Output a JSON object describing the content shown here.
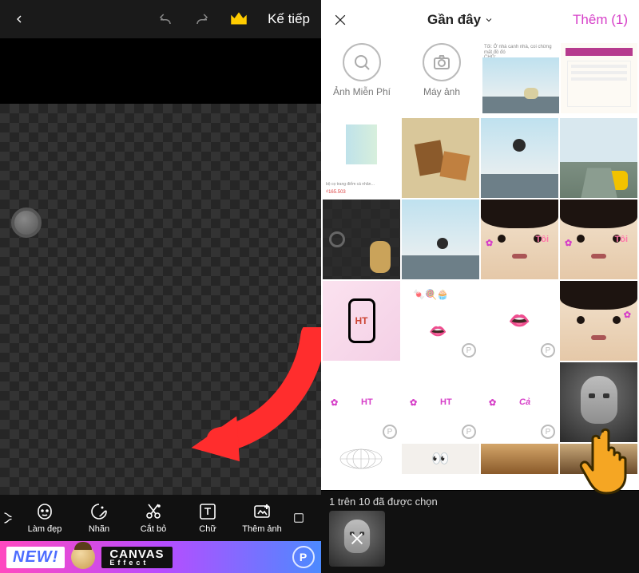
{
  "left": {
    "next_label": "Kế tiếp",
    "toolbar": [
      {
        "label": "Làm đẹp",
        "icon": "face-icon"
      },
      {
        "label": "Nhãn",
        "icon": "sticker-icon"
      },
      {
        "label": "Cắt bỏ",
        "icon": "cutout-icon"
      },
      {
        "label": "Chữ",
        "icon": "text-icon"
      },
      {
        "label": "Thêm ảnh",
        "icon": "add-photo-icon"
      }
    ],
    "banner": {
      "new": "NEW!",
      "title": "CANVAS",
      "subtitle": "Effect"
    }
  },
  "right": {
    "close": "✕",
    "title": "Gần đây",
    "add_label": "Thêm (1)",
    "quick": {
      "free": "Ảnh Miễn Phí",
      "camera": "Máy ảnh"
    },
    "stickers": {
      "ht": "HT",
      "ca": "Cả"
    },
    "selected_template": "{n} trên {m} đã được chọn",
    "selected_n": 1,
    "selected_m": 10
  }
}
